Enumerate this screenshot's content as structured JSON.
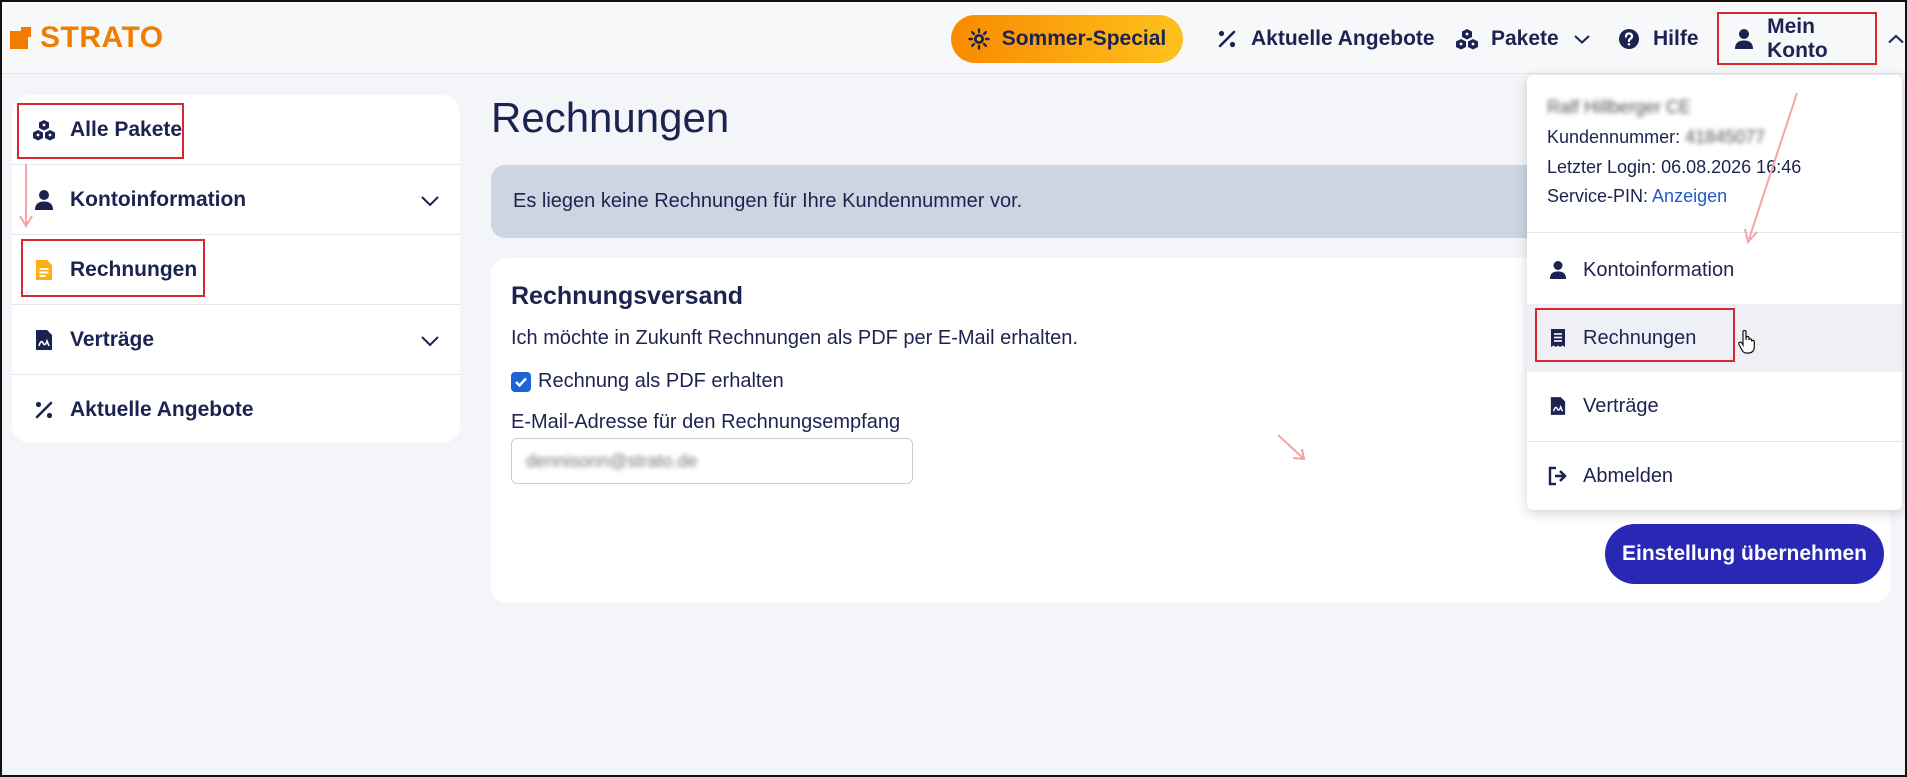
{
  "brand": {
    "name": "STRATO"
  },
  "header": {
    "special_label": "Sommer-Special",
    "offers_label": "Aktuelle Angebote",
    "packages_label": "Pakete",
    "help_label": "Hilfe",
    "account_label": "Mein Konto"
  },
  "sidebar": {
    "items": [
      {
        "label": "Alle Pakete",
        "icon": "packages-icon"
      },
      {
        "label": "Kontoinformation",
        "icon": "user-icon"
      },
      {
        "label": "Rechnungen",
        "icon": "invoice-icon"
      },
      {
        "label": "Verträge",
        "icon": "contract-icon"
      },
      {
        "label": "Aktuelle Angebote",
        "icon": "percent-icon"
      }
    ]
  },
  "main": {
    "title": "Rechnungen",
    "info_message": "Es liegen keine Rechnungen für Ihre Kundennummer vor.",
    "card": {
      "heading": "Rechnungsversand",
      "description": "Ich möchte in Zukunft Rechnungen als PDF per E-Mail erhalten.",
      "checkbox_label": "Rechnung als PDF erhalten",
      "checkbox_checked": true,
      "email_label": "E-Mail-Adresse für den Rechnungsempfang",
      "email_value": "dennisonn@strato.de",
      "submit_label": "Einstellung übernehmen"
    }
  },
  "account_menu": {
    "customer_name": "Ralf Hillberger CE",
    "customer_number_label": "Kundennummer:",
    "customer_number_value": "41845077",
    "last_login_label": "Letzter Login:",
    "last_login_value": "06.08.2026 16:46",
    "service_pin_label": "Service-PIN:",
    "service_pin_link": "Anzeigen",
    "items": [
      {
        "label": "Kontoinformation",
        "icon": "user-icon"
      },
      {
        "label": "Rechnungen",
        "icon": "receipt-icon"
      },
      {
        "label": "Verträge",
        "icon": "contract-icon"
      },
      {
        "label": "Abmelden",
        "icon": "logout-icon"
      }
    ]
  },
  "colors": {
    "brand_orange": "#f07c00",
    "navy": "#1d2350",
    "button_blue": "#2828b4",
    "info_bg": "#cdd4e2",
    "highlight_red": "#d9272e"
  }
}
